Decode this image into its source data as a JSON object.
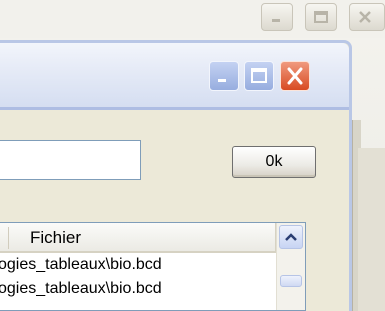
{
  "dialog": {
    "ok_label": "0k",
    "path_value": "",
    "list": {
      "columns": [
        "Fichier"
      ],
      "rows": [
        "ogies_tableaux\\bio.bcd",
        "ogies_tableaux\\bio.bcd"
      ]
    }
  },
  "colors": {
    "dialog_title_gradient_top": "#f2f5fb",
    "dialog_frame": "#b9c7e6",
    "close_button": "#d84b22",
    "window_face": "#ece9d8"
  },
  "icons": {
    "minimize": "minimize-icon",
    "maximize": "maximize-icon",
    "close": "close-icon",
    "scroll_up": "chevron-up-icon"
  }
}
